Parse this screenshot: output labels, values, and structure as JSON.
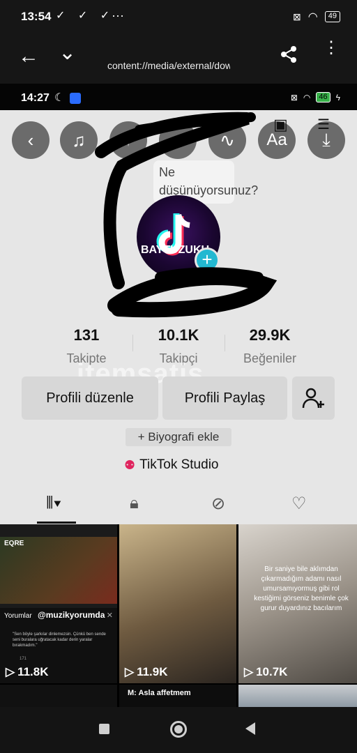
{
  "status_outer": {
    "time": "13:54",
    "checks": "✓ ✓ ✓",
    "dots": "···",
    "battery": "49"
  },
  "viewer": {
    "url": "content://media/external/down"
  },
  "status_inner": {
    "time": "14:27",
    "battery": "46"
  },
  "toolbar": {
    "text_tool": "Aa"
  },
  "bubble": {
    "text": "Ne düşünüyorsunuz?"
  },
  "avatar": {
    "brand": "BAYTUZUKU"
  },
  "stats": [
    {
      "value": "131",
      "label": "Takipte"
    },
    {
      "value": "10.1K",
      "label": "Takipçi"
    },
    {
      "value": "29.9K",
      "label": "Beğeniler"
    }
  ],
  "buttons": {
    "edit": "Profili düzenle",
    "share": "Profili Paylaş"
  },
  "bio": "+ Biyografi ekle",
  "studio": "TikTok Studio",
  "watermark": "itemsatis",
  "videos": [
    {
      "views": "11.8K",
      "overlay_title": "Yorumlar",
      "overlay_handle": "@muzikyorumda",
      "overlay_comment": "\"Sen böyle şarkılar dinlemezsin. Çünkü ben sende seni buralara uğratacak kadar derin yaralar bırakmadım.\"",
      "top_logo": "EQRE",
      "comment_count": "171"
    },
    {
      "views": "11.9K"
    },
    {
      "views": "10.7K",
      "overlay_text": "Bir saniye bile aklımdan çıkarmadığım adamı nasıl umursamıyormuş gibi rol kestiğimi görseniz benimle çok gurur duyardınız bacılarım"
    }
  ],
  "row2": {
    "caption": "M: Asla affetmem"
  }
}
